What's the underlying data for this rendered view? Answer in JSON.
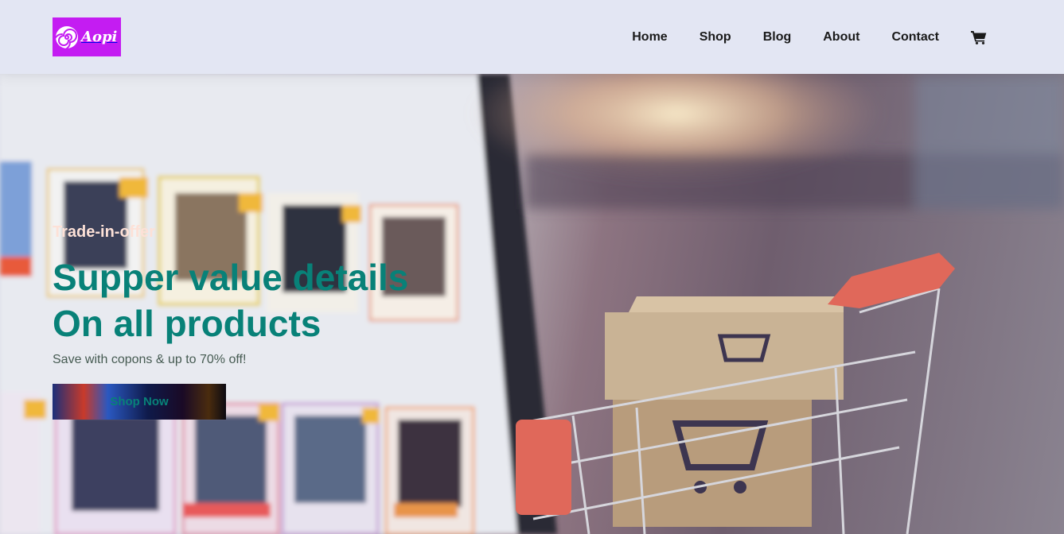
{
  "brand": {
    "logo_text": "Aopi",
    "logo_color": "#c41cf2"
  },
  "nav": {
    "items": [
      {
        "label": "Home"
      },
      {
        "label": "Shop"
      },
      {
        "label": "Blog"
      },
      {
        "label": "About"
      },
      {
        "label": "Contact"
      }
    ],
    "cart_icon": "shopping-cart-icon"
  },
  "hero": {
    "eyebrow": "Trade-in-offer",
    "heading_line1": "Supper value details",
    "heading_line2": "On all products",
    "subtext": "Save with copons & up to 70% off!",
    "button_label": "Shop Now",
    "accent_color": "#088178",
    "background": "blurred laptop screen with shopping website and a miniature shopping cart holding cardboard boxes"
  }
}
